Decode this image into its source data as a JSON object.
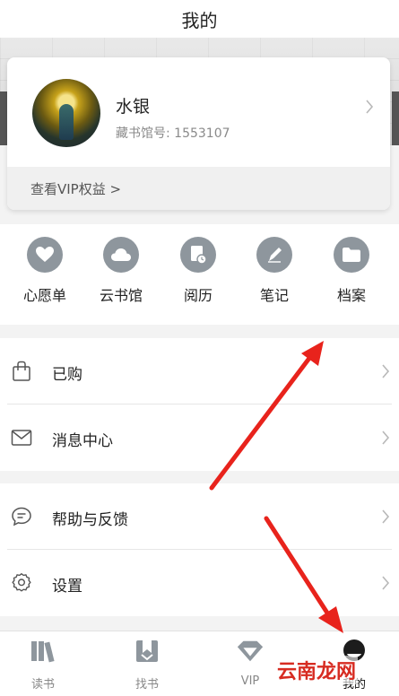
{
  "header": {
    "title": "我的"
  },
  "profile": {
    "name": "水银",
    "id_text": "藏书馆号: 1553107",
    "vip_text": "查看VIP权益 >"
  },
  "quick_actions": [
    {
      "label": "心愿单",
      "icon": "heart-icon"
    },
    {
      "label": "云书馆",
      "icon": "cloud-icon"
    },
    {
      "label": "阅历",
      "icon": "history-icon"
    },
    {
      "label": "笔记",
      "icon": "pen-icon"
    },
    {
      "label": "档案",
      "icon": "folder-icon"
    }
  ],
  "list_groups": [
    {
      "items": [
        {
          "label": "已购",
          "icon": "bag-icon"
        },
        {
          "label": "消息中心",
          "icon": "mail-icon"
        }
      ]
    },
    {
      "items": [
        {
          "label": "帮助与反馈",
          "icon": "chat-icon"
        },
        {
          "label": "设置",
          "icon": "gear-icon"
        }
      ]
    }
  ],
  "tabs": [
    {
      "label": "读书",
      "icon": "books-icon"
    },
    {
      "label": "找书",
      "icon": "bookmark-download-icon"
    },
    {
      "label": "VIP",
      "icon": "diamond-icon"
    },
    {
      "label": "我的",
      "icon": "user-icon",
      "active": true
    }
  ],
  "watermark": "云南龙网",
  "colors": {
    "icon_gray": "#8e969d",
    "arrow_red": "#e8231c",
    "bg": "#f3f3f3"
  }
}
